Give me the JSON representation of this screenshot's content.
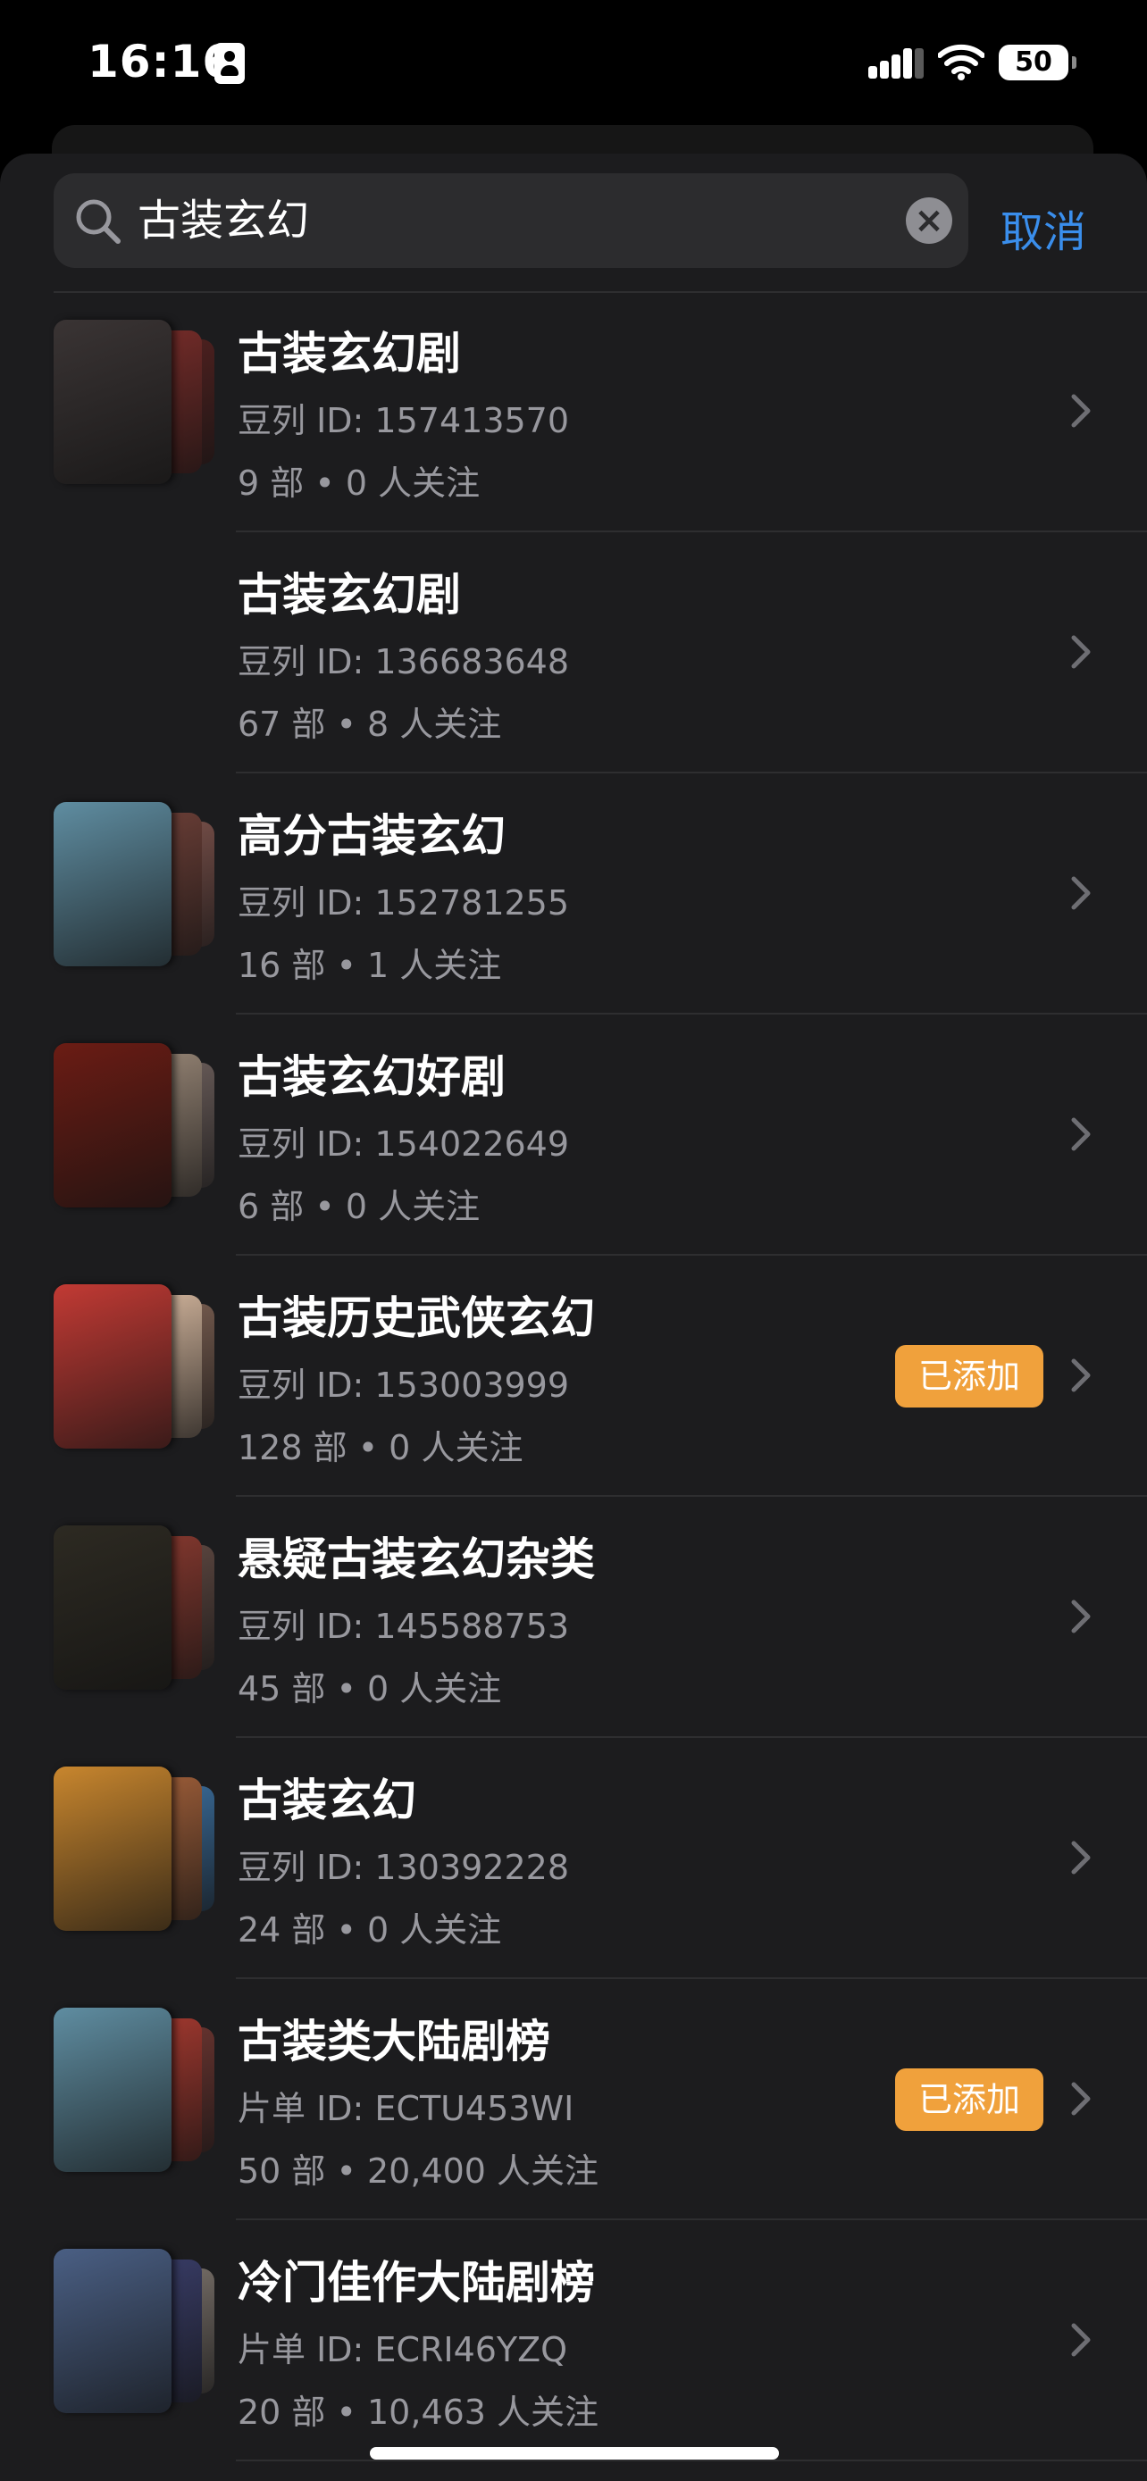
{
  "status_bar": {
    "time": "16:16",
    "battery_level": "50",
    "icons": [
      "person-badge-icon",
      "cellular-signal-icon",
      "wifi-icon",
      "battery-icon"
    ]
  },
  "search": {
    "value": "古装玄幻",
    "cancel_label": "取消"
  },
  "badge_added_label": "已添加",
  "results": [
    {
      "title": "古装玄幻剧",
      "list_id": "豆列 ID: 157413570",
      "meta": "9 部 • 0 人关注",
      "added": false,
      "has_covers": true,
      "colors": [
        "#3a3434",
        "#7a2d2a",
        "#5a2220"
      ]
    },
    {
      "title": "古装玄幻剧",
      "list_id": "豆列 ID: 136683648",
      "meta": "67 部 • 8 人关注",
      "added": false,
      "has_covers": false,
      "colors": []
    },
    {
      "title": "高分古装玄幻",
      "list_id": "豆列 ID: 152781255",
      "meta": "16 部 • 1 人关注",
      "added": false,
      "has_covers": true,
      "colors": [
        "#5f8da1",
        "#6e4038",
        "#8a5a52"
      ]
    },
    {
      "title": "古装玄幻好剧",
      "list_id": "豆列 ID: 154022649",
      "meta": "6 部 • 0 人关注",
      "added": false,
      "has_covers": true,
      "colors": [
        "#6b1c14",
        "#9a8878",
        "#7a6a66"
      ]
    },
    {
      "title": "古装历史武侠玄幻",
      "list_id": "豆列 ID: 153003999",
      "meta": "128 部 • 0 人关注",
      "added": true,
      "has_covers": true,
      "colors": [
        "#c23a34",
        "#d7b9a0",
        "#8a6a5a"
      ]
    },
    {
      "title": "悬疑古装玄幻杂类",
      "list_id": "豆列 ID: 145588753",
      "meta": "45 部 • 0 人关注",
      "added": false,
      "has_covers": true,
      "colors": [
        "#2d2a22",
        "#8a3a30",
        "#6a5048"
      ]
    },
    {
      "title": "古装玄幻",
      "list_id": "豆列 ID: 130392228",
      "meta": "24 部 • 0 人关注",
      "added": false,
      "has_covers": true,
      "colors": [
        "#c8862e",
        "#a2603a",
        "#3f7ab0"
      ]
    },
    {
      "title": "古装类大陆剧榜",
      "list_id": "片单 ID: ECTU453WI",
      "meta": "50 部 • 20,400 人关注",
      "added": true,
      "has_covers": true,
      "colors": [
        "#5f8da1",
        "#a83a30",
        "#7a3a34"
      ]
    },
    {
      "title": "冷门佳作大陆剧榜",
      "list_id": "片单 ID: ECRI46YZQ",
      "meta": "20 部 • 10,463 人关注",
      "added": false,
      "has_covers": true,
      "colors": [
        "#4a5f84",
        "#3a3e6a",
        "#8a8078"
      ]
    }
  ]
}
